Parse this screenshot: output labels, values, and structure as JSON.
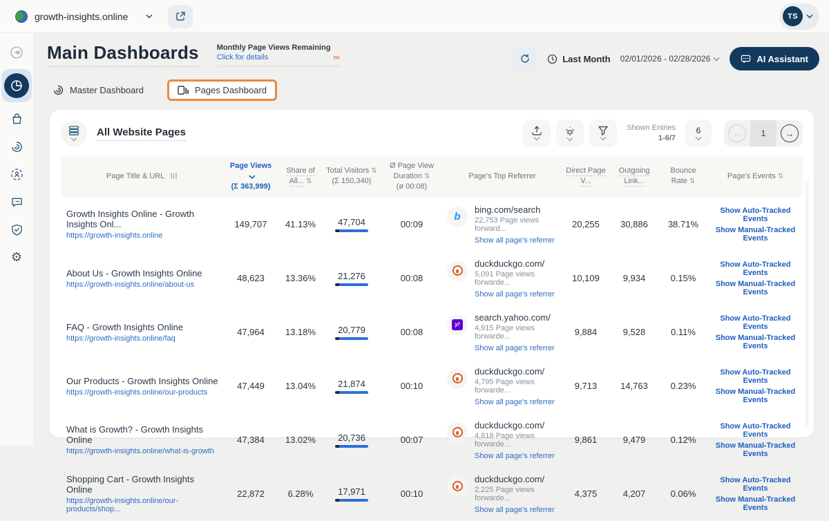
{
  "colors": {
    "navy": "#133a5e",
    "link_blue": "#2a6bc8",
    "sorted_header_blue": "#1d5fc0",
    "visitor_bar_blue": "#2f6fd8",
    "highlight_orange": "#e88a3c",
    "infinity_orange": "#ef7d45"
  },
  "topbar": {
    "domain": "growth-insights.online",
    "avatar_initials": "TS"
  },
  "header": {
    "title": "Main Dashboards",
    "quota": {
      "label": "Monthly Page Views Remaining",
      "link": "Click for details",
      "value": "∞"
    },
    "period": {
      "preset": "Last Month",
      "range": "02/01/2026 - 02/28/2026"
    },
    "ai_assistant": "AI Assistant"
  },
  "tabs": [
    {
      "label": "Master Dashboard"
    },
    {
      "label": "Pages Dashboard"
    }
  ],
  "panel": {
    "title": "All Website Pages",
    "shown_entries_label": "Shown Entries",
    "shown_entries_value": "1-6/7",
    "page_size": "6",
    "page_number": "1"
  },
  "table": {
    "headers": {
      "title": "Page Title & URL",
      "page_views": "Page Views",
      "page_views_sum": "(Σ 363,999)",
      "share": "Share of All...",
      "visitors": "Total Visitors",
      "visitors_sum": "(Σ 150,340)",
      "duration": "Ø Page View Duration",
      "duration_avg": "(ø 00:08)",
      "referrer": "Page's Top Referrer",
      "direct": "Direct Page V...",
      "outgoing": "Outgoing Link...",
      "bounce": "Bounce Rate",
      "events": "Page's Events"
    },
    "referrer_link": "Show all page's referrer",
    "events_links": [
      "Show Auto-Tracked Events",
      "Show Manual-Tracked Events"
    ],
    "rows": [
      {
        "title": "Growth Insights Online - Growth Insights Onl...",
        "url": "https://growth-insights.online",
        "page_views": "149,707",
        "share": "41.13%",
        "visitors": "47,704",
        "duration": "00:09",
        "referrer": {
          "icon": "bing",
          "name": "bing.com/search",
          "forwarded": "22,753 Page views forward..."
        },
        "direct": "20,255",
        "outgoing": "30,886",
        "bounce": "38.71%"
      },
      {
        "title": "About Us - Growth Insights Online",
        "url": "https://growth-insights.online/about-us",
        "page_views": "48,623",
        "share": "13.36%",
        "visitors": "21,276",
        "duration": "00:08",
        "referrer": {
          "icon": "duckduckgo",
          "name": "duckduckgo.com/",
          "forwarded": "5,091 Page views forwarde..."
        },
        "direct": "10,109",
        "outgoing": "9,934",
        "bounce": "0.15%"
      },
      {
        "title": "FAQ - Growth Insights Online",
        "url": "https://growth-insights.online/faq",
        "page_views": "47,964",
        "share": "13.18%",
        "visitors": "20,779",
        "duration": "00:08",
        "referrer": {
          "icon": "yahoo",
          "name": "search.yahoo.com/",
          "forwarded": "4,915 Page views forwarde..."
        },
        "direct": "9,884",
        "outgoing": "9,528",
        "bounce": "0.11%"
      },
      {
        "title": "Our Products - Growth Insights Online",
        "url": "https://growth-insights.online/our-products",
        "page_views": "47,449",
        "share": "13.04%",
        "visitors": "21,874",
        "duration": "00:10",
        "referrer": {
          "icon": "duckduckgo",
          "name": "duckduckgo.com/",
          "forwarded": "4,795 Page views forwarde..."
        },
        "direct": "9,713",
        "outgoing": "14,763",
        "bounce": "0.23%"
      },
      {
        "title": "What is Growth? - Growth Insights Online",
        "url": "https://growth-insights.online/what-is-growth",
        "page_views": "47,384",
        "share": "13.02%",
        "visitors": "20,736",
        "duration": "00:07",
        "referrer": {
          "icon": "duckduckgo",
          "name": "duckduckgo.com/",
          "forwarded": "4,818 Page views forwarde..."
        },
        "direct": "9,861",
        "outgoing": "9,479",
        "bounce": "0.12%"
      },
      {
        "title": "Shopping Cart - Growth Insights Online",
        "url": "https://growth-insights.online/our-products/shop...",
        "page_views": "22,872",
        "share": "6.28%",
        "visitors": "17,971",
        "duration": "00:10",
        "referrer": {
          "icon": "duckduckgo",
          "name": "duckduckgo.com/",
          "forwarded": "2,225 Page views forwarde..."
        },
        "direct": "4,375",
        "outgoing": "4,207",
        "bounce": "0.06%"
      }
    ]
  }
}
